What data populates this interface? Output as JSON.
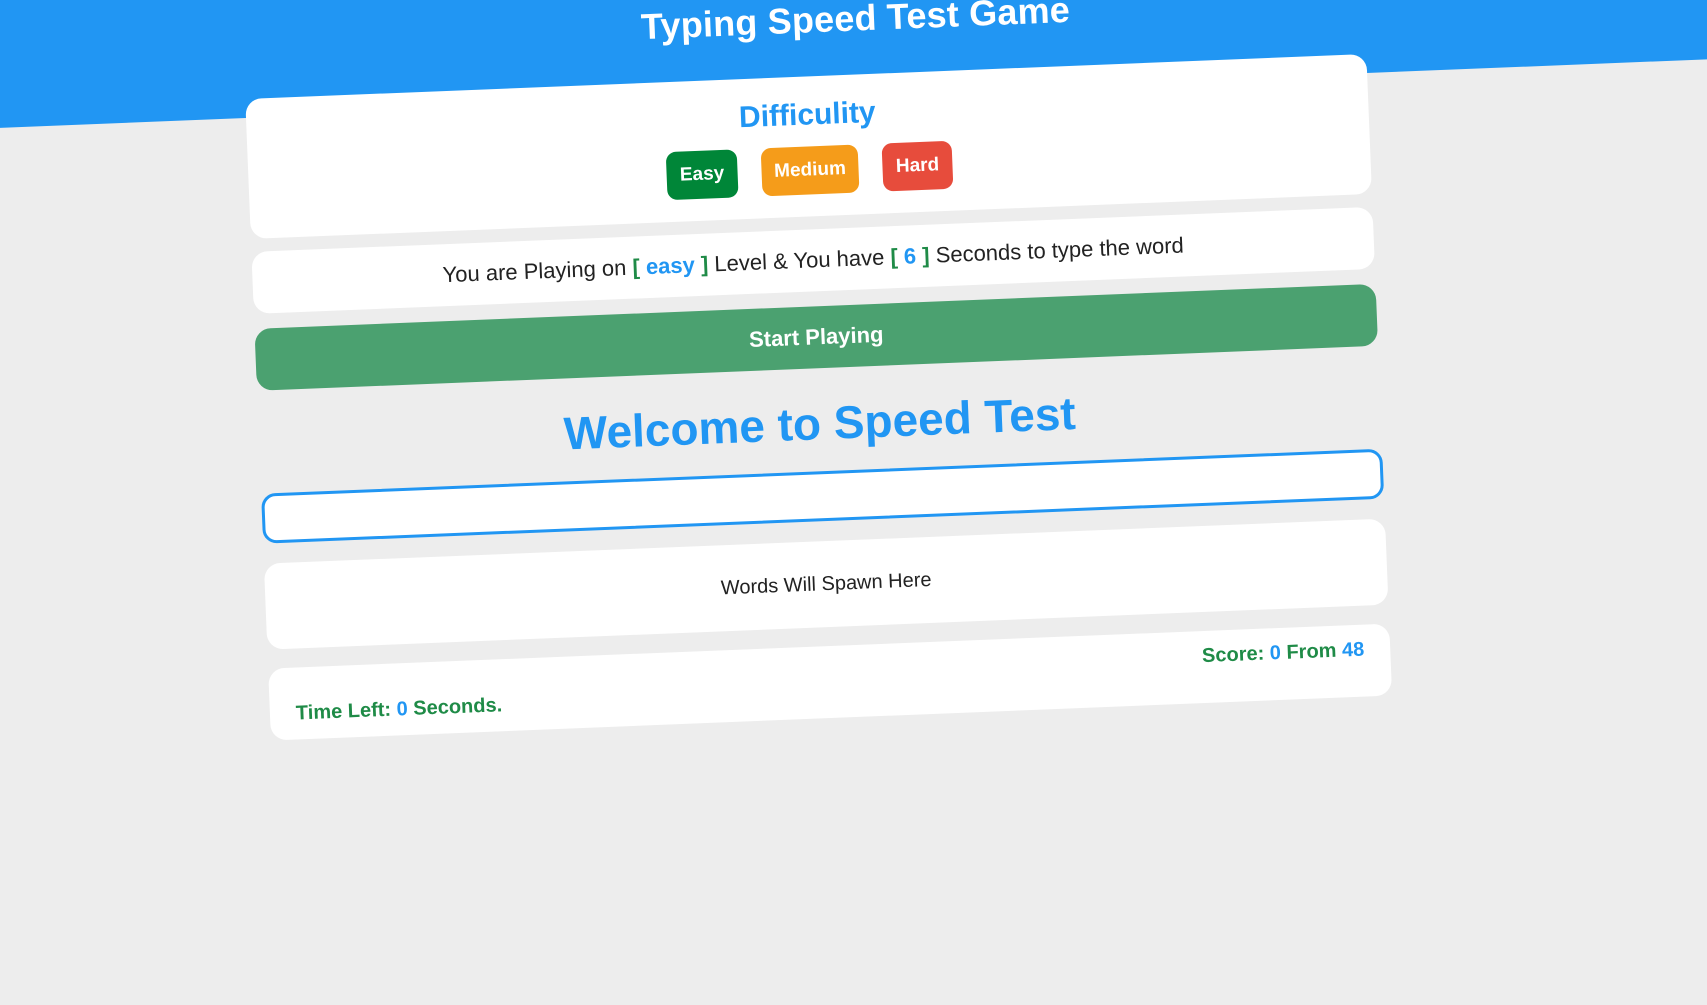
{
  "header": {
    "title": "Typing Speed Test Game"
  },
  "difficulty": {
    "title": "Difficulity",
    "buttons": {
      "easy": "Easy",
      "medium": "Medium",
      "hard": "Hard"
    }
  },
  "info": {
    "prefix": "You are Playing on",
    "bracket_open": "[",
    "bracket_close": "]",
    "level": "easy",
    "middle": "Level & You have",
    "seconds": "6",
    "suffix": "Seconds to type the word"
  },
  "start_button": "Start Playing",
  "welcome": "Welcome to Speed Test",
  "input": {
    "value": "",
    "placeholder": ""
  },
  "words": {
    "placeholder_text": "Words Will Spawn Here"
  },
  "stats": {
    "time_left_label": "Time Left:",
    "time_left_value": "0",
    "time_left_unit": "Seconds.",
    "score_label": "Score:",
    "score_value": "0",
    "score_from_label": "From",
    "score_total": "48"
  },
  "colors": {
    "primary": "#2196f3",
    "easy": "#008638",
    "medium": "#f59c1a",
    "hard": "#e74c3c",
    "start": "#4ba170",
    "stats_text": "#1f8b47",
    "background": "#ededed"
  }
}
